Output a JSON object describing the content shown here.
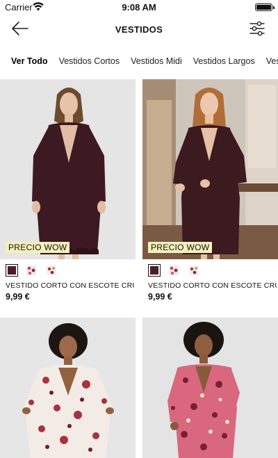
{
  "status_bar": {
    "carrier": "Carrier",
    "time": "9:08 AM"
  },
  "nav": {
    "title": "VESTIDOS"
  },
  "tabs": [
    {
      "label": "Ver Todo",
      "active": true
    },
    {
      "label": "Vestidos Cortos"
    },
    {
      "label": "Vestidos Midi"
    },
    {
      "label": "Vestidos Largos"
    },
    {
      "label": "Vestido"
    }
  ],
  "products": [
    {
      "badge": "PRECIO WOW",
      "name": "VESTIDO CORTO CON ESCOTE CRU...",
      "price": "9,99 €"
    },
    {
      "badge": "PRECIO WOW",
      "name": "VESTIDO CORTO CON ESCOTE CRU...",
      "price": "9,99 €"
    },
    {
      "badge": "",
      "name": "",
      "price": ""
    },
    {
      "badge": "",
      "name": "",
      "price": ""
    }
  ],
  "colors": {
    "wine": "#4a1f24",
    "badge_bg": "#f5efbe",
    "photo_bg": "#e4e4e4"
  }
}
